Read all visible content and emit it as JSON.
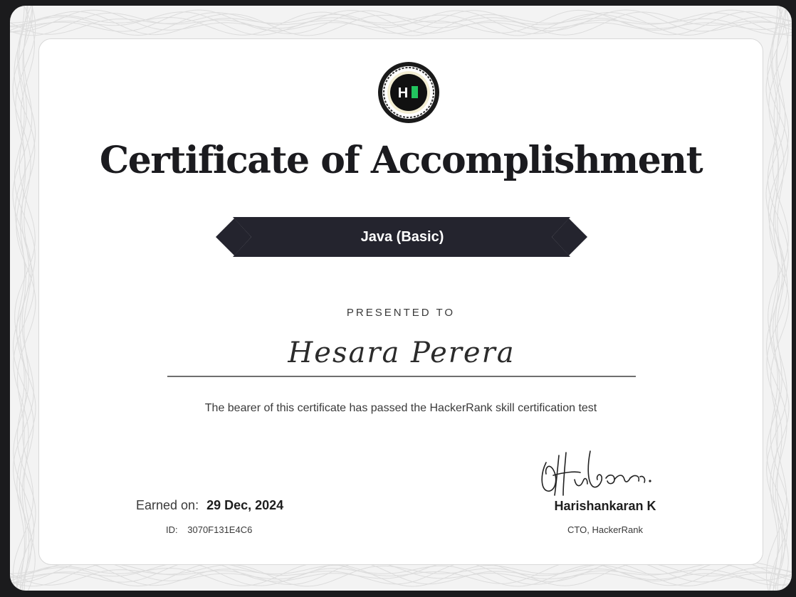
{
  "certificate": {
    "title": "Certificate of Accomplishment",
    "skill": "Java (Basic)",
    "presented_label": "PRESENTED TO",
    "recipient": "Hesara Perera",
    "statement": "The bearer of this certificate has passed the HackerRank skill certification test",
    "earned_label": "Earned on:",
    "earned_date": "29 Dec, 2024",
    "id_label": "ID:",
    "id_value": "3070F131E4C6",
    "signer_name": "Harishankaran K",
    "signer_title": "CTO, HackerRank"
  },
  "logo": {
    "letter": "H",
    "icon": "hackerrank-logo-icon"
  },
  "signature": {
    "icon": "signature-icon"
  },
  "colors": {
    "page_background": "#1b1b1d",
    "ribbon": "#24242e",
    "brand_green": "#1ba94c",
    "text_dark": "#1b1b1f"
  }
}
